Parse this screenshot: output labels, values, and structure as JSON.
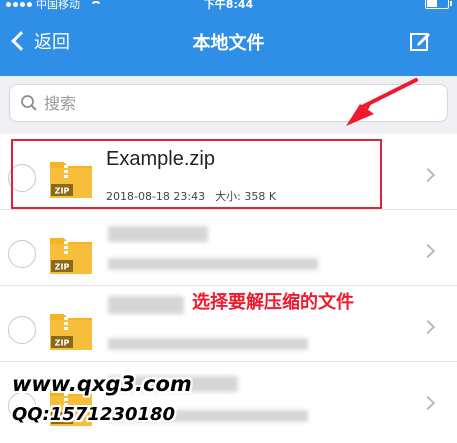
{
  "status_bar": {
    "carrier": "中国移动",
    "time": "下午8:44"
  },
  "nav": {
    "back_label": "返回",
    "title": "本地文件"
  },
  "search": {
    "placeholder": "搜索"
  },
  "files": [
    {
      "name": "Example.zip",
      "datetime": "2018-08-18 23:43",
      "size": "大小: 358 K",
      "icon_label": "ZIP"
    },
    {
      "icon_label": "ZIP"
    },
    {
      "icon_label": "ZIP"
    },
    {
      "icon_label": "ZIP"
    }
  ],
  "annotation": {
    "caption": "选择要解压缩的文件",
    "color": "#ee1b2f"
  },
  "watermark": {
    "site": "www.qxg3.com",
    "qq": "QQ:1571230180"
  },
  "colors": {
    "nav_bg": "#2f8fe6",
    "zip_icon": "#f5b323"
  }
}
